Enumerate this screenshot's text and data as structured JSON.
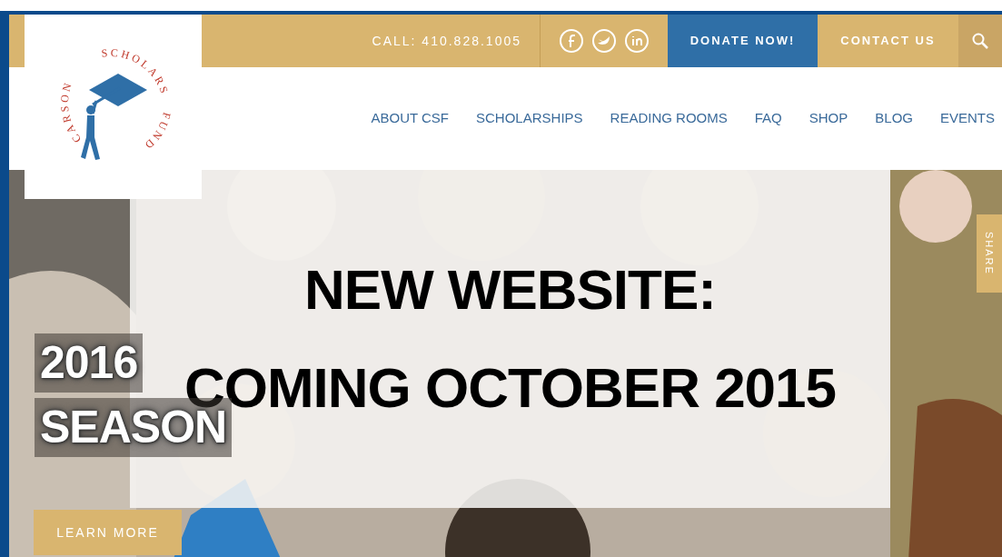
{
  "logo": {
    "words": [
      "CARSON",
      "SCHOLARS",
      "FUND"
    ]
  },
  "top_bar": {
    "phone": "CALL: 410.828.1005",
    "buttons": [
      {
        "label": "DONATE NOW!",
        "kind": "primary"
      },
      {
        "label": "CONTACT US",
        "kind": "plain"
      }
    ]
  },
  "nav": {
    "items": [
      "ABOUT CSF",
      "SCHOLARSHIPS",
      "READING ROOMS",
      "FAQ",
      "SHOP",
      "BLOG",
      "EVENTS"
    ]
  },
  "hero": {
    "title_lines": [
      "2016",
      "SEASON"
    ],
    "button": "LEARN MORE",
    "share": "SHARE"
  },
  "announcement": {
    "lines": [
      "NEW WEBSITE:",
      "COMING OCTOBER 2015"
    ]
  }
}
